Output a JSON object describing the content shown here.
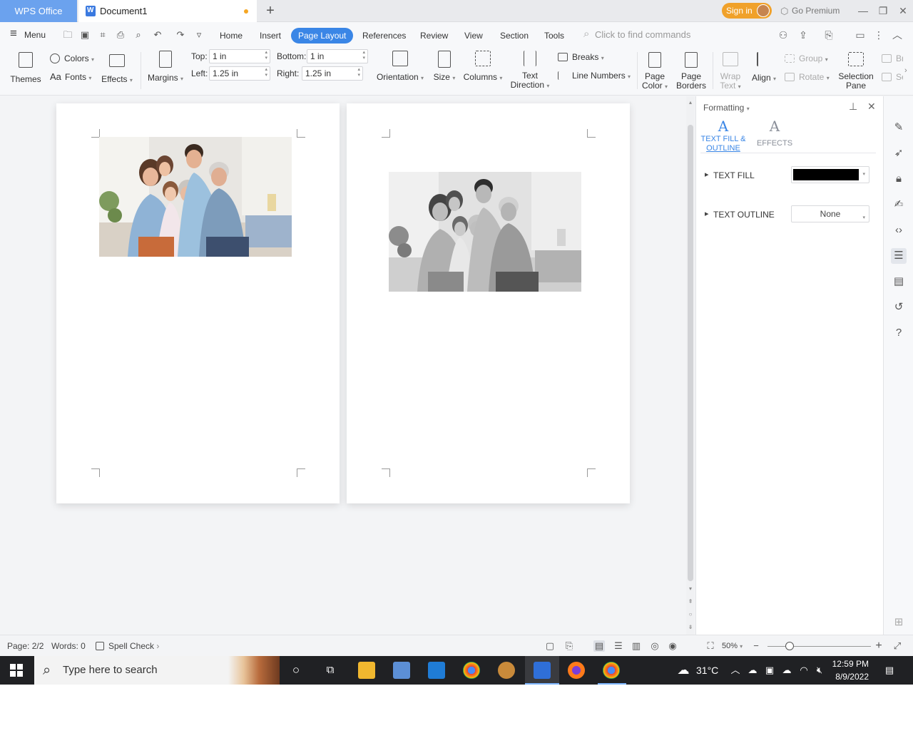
{
  "titlebar": {
    "brand": "WPS Office",
    "doc_tab": "Document1",
    "new_tab_symbol": "+",
    "sign_in": "Sign in",
    "premium": "Go Premium"
  },
  "menubar": {
    "menu_label": "Menu",
    "tabs": [
      "Home",
      "Insert",
      "Page Layout",
      "References",
      "Review",
      "View",
      "Section",
      "Tools"
    ],
    "active_tab": "Page Layout",
    "find_placeholder": "Click to find commands"
  },
  "ribbon": {
    "themes": "Themes",
    "colors": "Colors",
    "fonts": "Fonts",
    "fonts_glyph": "Aa",
    "effects": "Effects",
    "margins": "Margins",
    "top_label": "Top:",
    "top_value": "1 in",
    "bottom_label": "Bottom:",
    "bottom_value": "1 in",
    "left_label": "Left:",
    "left_value": "1.25 in",
    "right_label": "Right:",
    "right_value": "1.25 in",
    "orientation": "Orientation",
    "size": "Size",
    "columns": "Columns",
    "text_direction_1": "Text",
    "text_direction_2": "Direction",
    "breaks": "Breaks",
    "line_numbers": "Line Numbers",
    "page_color_1": "Page",
    "page_color_2": "Color",
    "page_borders_1": "Page",
    "page_borders_2": "Borders",
    "wrap_text_1": "Wrap",
    "wrap_text_2": "Text",
    "align": "Align",
    "group": "Group",
    "rotate": "Rotate",
    "selection_pane_1": "Selection",
    "selection_pane_2": "Pane",
    "overflow_1": "Br",
    "overflow_2": "Se"
  },
  "panel": {
    "title": "Formatting",
    "tab_fill_1": "TEXT FILL &",
    "tab_fill_2": "OUTLINE",
    "tab_effects": "EFFECTS",
    "tab_glyph": "A",
    "text_fill_label": "TEXT FILL",
    "text_fill_color": "#000000",
    "text_outline_label": "TEXT OUTLINE",
    "text_outline_value": "None"
  },
  "status": {
    "page": "Page: 2/2",
    "words": "Words: 0",
    "spell_check": "Spell Check",
    "zoom": "50%"
  },
  "taskbar": {
    "search_placeholder": "Type here to search",
    "temperature": "31°C",
    "time": "12:59 PM",
    "date": "8/9/2022"
  },
  "colors": {
    "accent": "#3a86e6",
    "brand_tab": "#6ba2ee",
    "sign_in": "#f0a12a"
  }
}
